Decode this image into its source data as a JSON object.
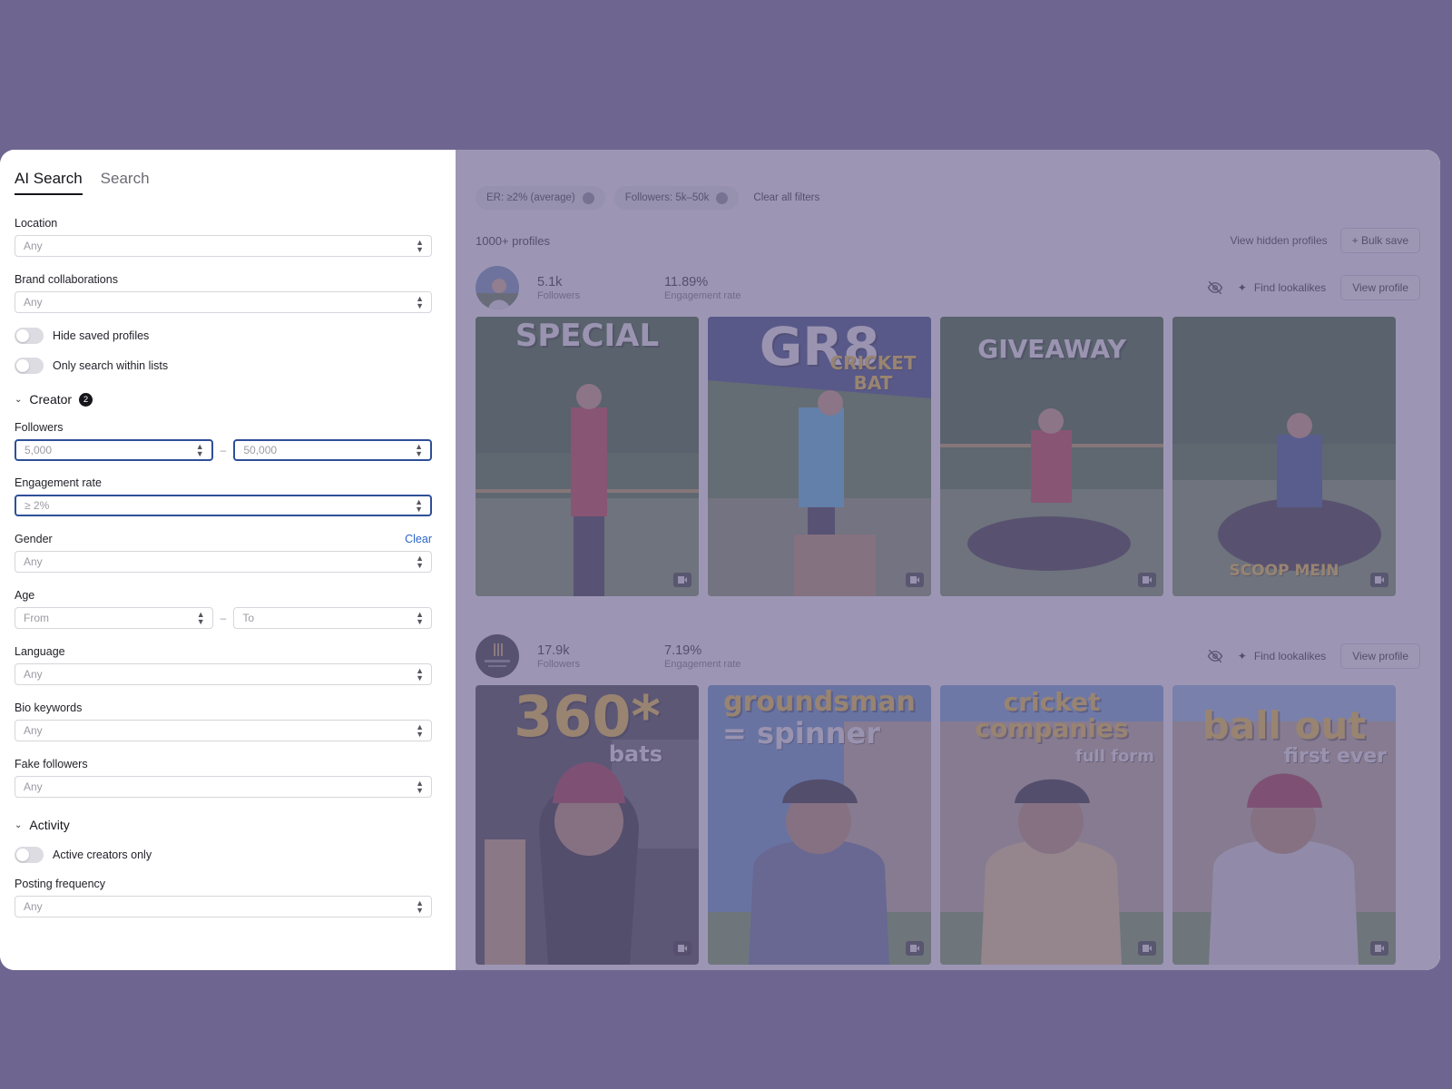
{
  "tabs": {
    "ai_search": "AI Search",
    "search": "Search"
  },
  "filters": {
    "location": {
      "label": "Location",
      "value": "Any"
    },
    "brand": {
      "label": "Brand collaborations",
      "value": "Any"
    },
    "hide_saved": "Hide saved profiles",
    "only_lists": "Only search within lists",
    "creator": {
      "label": "Creator",
      "count": "2"
    },
    "followers": {
      "label": "Followers",
      "min": "5,000",
      "max": "50,000",
      "dash": "–"
    },
    "engagement": {
      "label": "Engagement rate",
      "value": "≥ 2%"
    },
    "gender": {
      "label": "Gender",
      "clear": "Clear",
      "value": "Any"
    },
    "age": {
      "label": "Age",
      "from": "From",
      "to": "To",
      "dash": "–"
    },
    "language": {
      "label": "Language",
      "value": "Any"
    },
    "bio": {
      "label": "Bio keywords",
      "value": "Any"
    },
    "fake": {
      "label": "Fake followers",
      "value": "Any"
    },
    "activity": {
      "label": "Activity"
    },
    "active_only": "Active creators only",
    "posting": {
      "label": "Posting frequency",
      "value": "Any"
    }
  },
  "chips": {
    "er": "ER: ≥2% (average)",
    "followers": "Followers: 5k–50k",
    "clear_all": "Clear all filters"
  },
  "results": {
    "count": "1000+ profiles",
    "view_hidden": "View hidden profiles",
    "bulk_save": "+ Bulk save",
    "find_lookalikes": "Find lookalikes",
    "view_profile": "View profile",
    "followers_label": "Followers",
    "er_label": "Engagement rate"
  },
  "profiles": [
    {
      "followers": "5.1k",
      "er": "11.89%",
      "thumbs": [
        {
          "title": "SPECIAL",
          "sub": ""
        },
        {
          "title": "GR8",
          "sub": "CRICKET BAT"
        },
        {
          "title": "GIVEAWAY",
          "sub": ""
        },
        {
          "title": "",
          "sub": "SCOOP MEIN"
        }
      ]
    },
    {
      "followers": "17.9k",
      "er": "7.19%",
      "thumbs": [
        {
          "title": "360*",
          "sub": "bats"
        },
        {
          "title": "groundsman",
          "sub": "= spinner"
        },
        {
          "title": "cricket companies",
          "sub": "full form"
        },
        {
          "title": "ball out",
          "sub": "first ever"
        }
      ]
    }
  ],
  "colors": {
    "backdrop": "#6e6690",
    "focus_border": "#2f4f99",
    "link": "#2a66c8"
  },
  "icons": [
    "chevron-down-icon",
    "sort-icon",
    "eye-off-icon",
    "sparkle-icon",
    "video-icon",
    "close-icon"
  ]
}
